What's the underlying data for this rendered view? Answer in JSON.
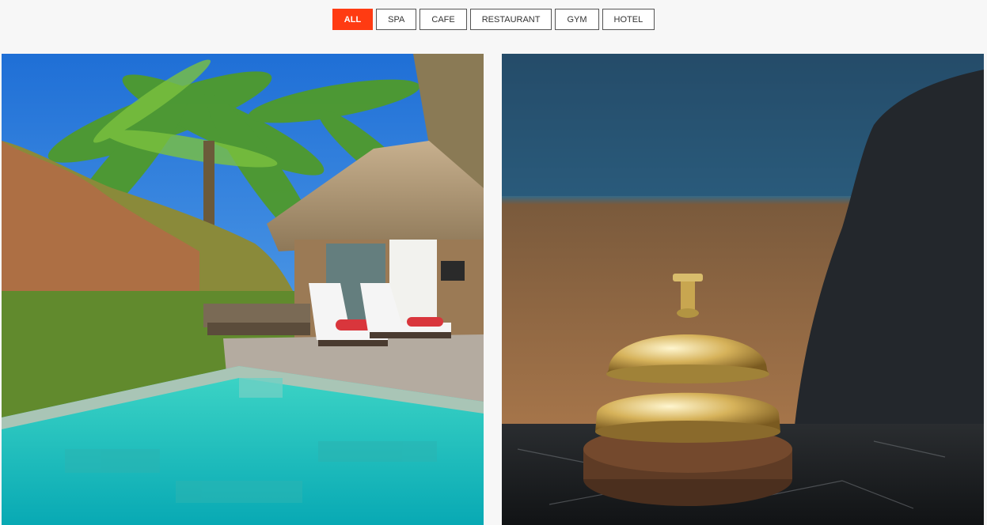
{
  "filters": [
    {
      "label": "ALL",
      "active": true
    },
    {
      "label": "SPA",
      "active": false
    },
    {
      "label": "CAFE",
      "active": false
    },
    {
      "label": "RESTAURANT",
      "active": false
    },
    {
      "label": "GYM",
      "active": false
    },
    {
      "label": "HOTEL",
      "active": false
    }
  ],
  "gallery": {
    "items": [
      {
        "image": "resort-pool-villa"
      },
      {
        "image": "hotel-reception-bell"
      }
    ]
  },
  "colors": {
    "accent": "#ff3b12",
    "page_background": "#f7f7f7"
  }
}
